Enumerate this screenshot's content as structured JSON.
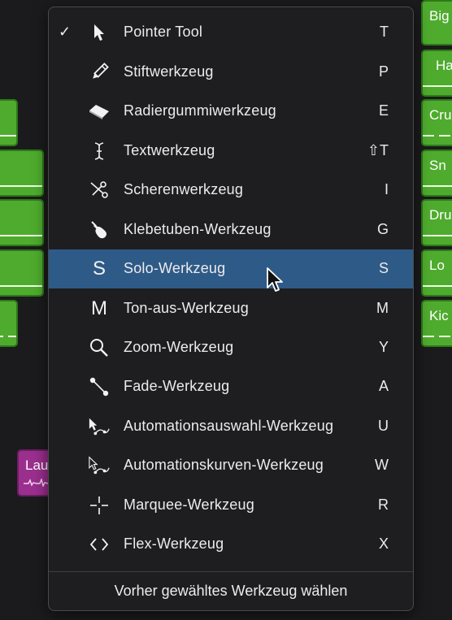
{
  "colors": {
    "menu_bg": "#1e1e20",
    "selection": "#2e5a87",
    "region_green": "#4fab2e",
    "region_magenta": "#9b2f8e"
  },
  "background_regions": [
    {
      "label": ""
    },
    {
      "label": ""
    },
    {
      "label": ""
    },
    {
      "label": ""
    },
    {
      "label": ""
    },
    {
      "label": "Big"
    },
    {
      "label": "Ha"
    },
    {
      "label": "Cru"
    },
    {
      "label": "Sn"
    },
    {
      "label": "Dru"
    },
    {
      "label": "Lo"
    },
    {
      "label": "Kic"
    },
    {
      "label": "Lau"
    }
  ],
  "menu": {
    "items": [
      {
        "label": "Pointer Tool",
        "shortcut": "T",
        "checked": true,
        "icon": "arrow-pointer-icon"
      },
      {
        "label": "Stiftwerkzeug",
        "shortcut": "P",
        "icon": "pencil-icon"
      },
      {
        "label": "Radiergummiwerkzeug",
        "shortcut": "E",
        "icon": "eraser-icon"
      },
      {
        "label": "Textwerkzeug",
        "shortcut": "⇧T",
        "icon": "text-cursor-icon"
      },
      {
        "label": "Scherenwerkzeug",
        "shortcut": "I",
        "icon": "scissors-icon"
      },
      {
        "label": "Klebetuben-Werkzeug",
        "shortcut": "G",
        "icon": "glue-tube-icon"
      },
      {
        "label": "Solo-Werkzeug",
        "shortcut": "S",
        "selected": true,
        "icon": "solo-icon",
        "glyph": "S"
      },
      {
        "label": "Ton-aus-Werkzeug",
        "shortcut": "M",
        "icon": "mute-icon",
        "glyph": "M"
      },
      {
        "label": "Zoom-Werkzeug",
        "shortcut": "Y",
        "icon": "magnifier-icon"
      },
      {
        "label": "Fade-Werkzeug",
        "shortcut": "A",
        "icon": "fade-icon"
      },
      {
        "label": "Automationsauswahl-Werkzeug",
        "shortcut": "U",
        "icon": "automation-select-icon"
      },
      {
        "label": "Automationskurven-Werkzeug",
        "shortcut": "W",
        "icon": "automation-curve-icon"
      },
      {
        "label": "Marquee-Werkzeug",
        "shortcut": "R",
        "icon": "marquee-crosshair-icon"
      },
      {
        "label": "Flex-Werkzeug",
        "shortcut": "X",
        "icon": "flex-icon"
      }
    ],
    "footer": "Vorher gewähltes Werkzeug wählen",
    "check_glyph": "✓"
  }
}
